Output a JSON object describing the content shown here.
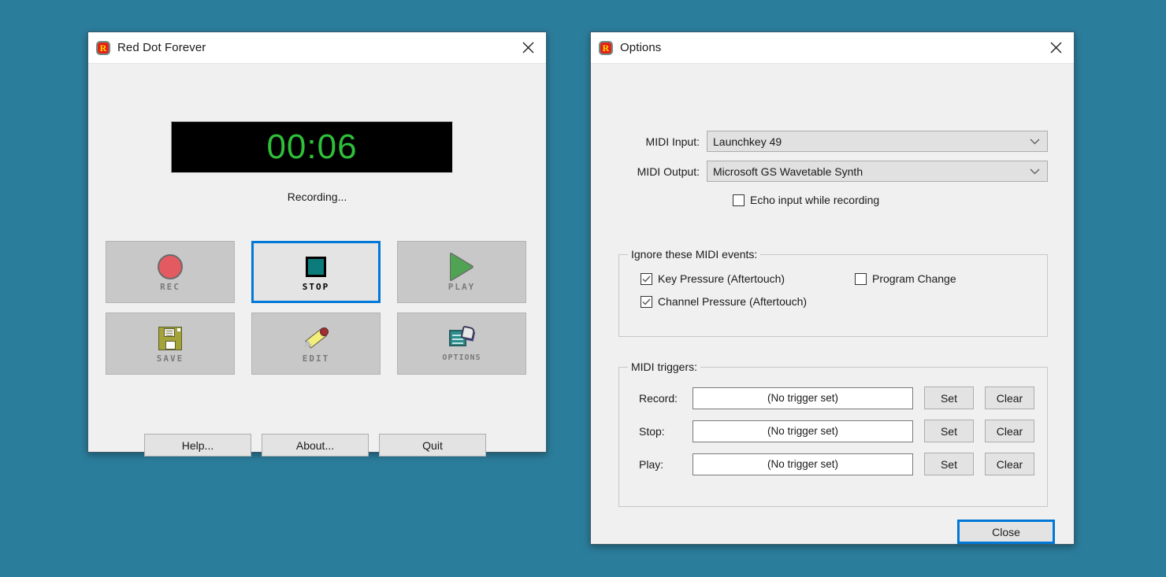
{
  "desktop": {
    "background_color": "#2b7d9c"
  },
  "main_window": {
    "title": "Red Dot Forever",
    "app_icon": "red-octagon-r-icon",
    "close_icon": "close-icon",
    "timer": "00:06",
    "timer_color": "#2fbf3a",
    "status": "Recording...",
    "transport_buttons": [
      {
        "label": "REC",
        "icon": "record-circle-icon",
        "focused": false
      },
      {
        "label": "STOP",
        "icon": "stop-square-icon",
        "focused": true
      },
      {
        "label": "PLAY",
        "icon": "play-triangle-icon",
        "focused": false
      },
      {
        "label": "SAVE",
        "icon": "floppy-disk-icon",
        "focused": false
      },
      {
        "label": "EDIT",
        "icon": "pencil-icon",
        "focused": false
      },
      {
        "label": "OPTIONS",
        "icon": "options-panel-icon",
        "focused": false
      }
    ],
    "bottom_buttons": [
      {
        "label": "Help..."
      },
      {
        "label": "About..."
      },
      {
        "label": "Quit"
      }
    ]
  },
  "options_window": {
    "title": "Options",
    "app_icon": "red-octagon-r-icon",
    "close_icon": "close-icon",
    "midi_input": {
      "label": "MIDI Input:",
      "value": "Launchkey 49"
    },
    "midi_output": {
      "label": "MIDI Output:",
      "value": "Microsoft GS Wavetable Synth"
    },
    "echo_checkbox": {
      "label": "Echo input while recording",
      "checked": false
    },
    "ignore_group": {
      "title": "Ignore these MIDI events:",
      "items": [
        {
          "label": "Key Pressure (Aftertouch)",
          "checked": true
        },
        {
          "label": "Program Change",
          "checked": false
        },
        {
          "label": "Channel Pressure (Aftertouch)",
          "checked": true
        }
      ]
    },
    "triggers_group": {
      "title": "MIDI triggers:",
      "set_label": "Set",
      "clear_label": "Clear",
      "rows": [
        {
          "label": "Record:",
          "value": "(No trigger set)"
        },
        {
          "label": "Stop:",
          "value": "(No trigger set)"
        },
        {
          "label": "Play:",
          "value": "(No trigger set)"
        }
      ]
    },
    "close_button": {
      "label": "Close",
      "focus_color": "#0078d7"
    }
  }
}
